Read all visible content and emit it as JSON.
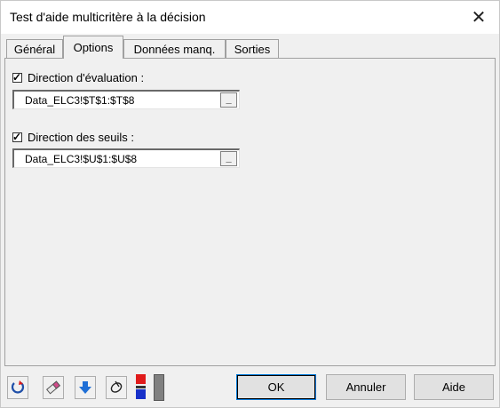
{
  "window": {
    "title": "Test d'aide multicritère à la décision",
    "close_glyph": "✕"
  },
  "tabs": [
    {
      "label": "Général"
    },
    {
      "label": "Options"
    },
    {
      "label": "Données manq."
    },
    {
      "label": "Sorties"
    }
  ],
  "active_tab": "Options",
  "options": {
    "eval_direction": {
      "label": "Direction d'évaluation :",
      "checked": true,
      "value": "Data_ELC3!$T$1:$T$8"
    },
    "threshold_direction": {
      "label": "Direction des seuils :",
      "checked": true,
      "value": "Data_ELC3!$U$1:$U$8"
    },
    "ref_button_glyph": "_"
  },
  "toolbar": {
    "icons": [
      "reset-icon",
      "eraser-icon",
      "down-arrow-icon",
      "tag-icon",
      "color-flags-icon"
    ]
  },
  "buttons": {
    "ok": "OK",
    "cancel": "Annuler",
    "help": "Aide"
  }
}
